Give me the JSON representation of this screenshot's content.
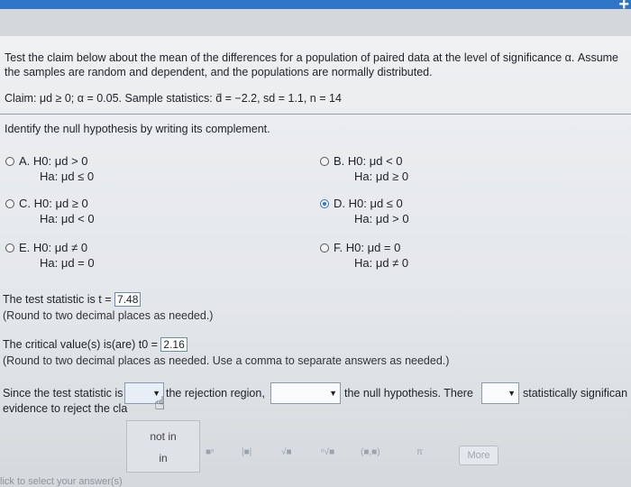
{
  "header": {
    "plus_icon": "plus-icon"
  },
  "instructions": {
    "line1": "Test the claim below about the mean of the differences for a population of paired data at the level of significance α. Assume",
    "line2": "the samples are random and dependent, and the populations are normally distributed."
  },
  "claim": "Claim: μd ≥ 0; α = 0.05. Sample statistics: d̄ = −2.2, sd = 1.1, n = 14",
  "identify": "Identify the null hypothesis by writing its complement.",
  "options": [
    {
      "label": "A.",
      "h0": "H0: μd > 0",
      "ha": "Ha: μd ≤ 0"
    },
    {
      "label": "B.",
      "h0": "H0: μd < 0",
      "ha": "Ha: μd ≥ 0"
    },
    {
      "label": "C.",
      "h0": "H0: μd ≥ 0",
      "ha": "Ha: μd < 0"
    },
    {
      "label": "D.",
      "h0": "H0: μd ≤ 0",
      "ha": "Ha: μd > 0"
    },
    {
      "label": "E.",
      "h0": "H0: μd ≠ 0",
      "ha": "Ha: μd = 0"
    },
    {
      "label": "F.",
      "h0": "H0: μd = 0",
      "ha": "Ha: μd ≠ 0"
    }
  ],
  "selected_option": "D.",
  "test_stat": {
    "prefix": "The test statistic is t =",
    "value": "7.48",
    "round": "(Round to two decimal places as needed.)"
  },
  "critical": {
    "prefix": "The critical value(s) is(are) t0 =",
    "value": "2.16",
    "round": "(Round to two decimal places as needed. Use a comma to separate answers as needed.)"
  },
  "conclusion": {
    "since": "Since the test statistic is",
    "rejection": "the rejection region,",
    "null_hyp": "the null hypothesis. There",
    "significant": "statistically significan",
    "evidence": "evidence to reject the cla"
  },
  "dropdown_options": [
    "not in",
    "in"
  ],
  "toolbar": {
    "more": "More"
  },
  "bottom_text": "lick to select your answer(s)"
}
